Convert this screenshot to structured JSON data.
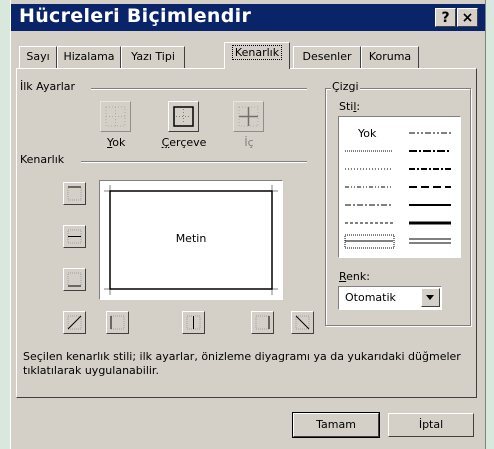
{
  "window": {
    "title": "Hücreleri Biçimlendir"
  },
  "title_buttons": {
    "help": "?",
    "close": "×"
  },
  "tabs": [
    {
      "label": "Sayı",
      "active": false
    },
    {
      "label": "Hizalama",
      "active": false
    },
    {
      "label": "Yazı Tipi",
      "active": false
    },
    {
      "label": "Kenarlık",
      "active": true
    },
    {
      "label": "Desenler",
      "active": false
    },
    {
      "label": "Koruma",
      "active": false
    }
  ],
  "presets": {
    "heading": "İlk Ayarlar",
    "none_first": "Y",
    "none_rest": "ok",
    "outline_first": "Ç",
    "outline_rest": "erçeve",
    "inside": "İç"
  },
  "border": {
    "heading": "Kenarlık",
    "preview_text": "Metin"
  },
  "line": {
    "heading": "Çizgi",
    "style_first": "Sti",
    "style_u": "l",
    "style_rest": ":",
    "none_label": "Yok",
    "color_first": "R",
    "color_rest": "enk:",
    "color_value": "Otomatik"
  },
  "hint": "Seçilen kenarlık stili; ilk ayarlar, önizleme diyagramı ya da yukarıdaki düğmeler tıklatılarak uygulanabilir.",
  "buttons": {
    "ok": "Tamam",
    "cancel": "İptal"
  },
  "colors": {
    "titlebar": "#0a246a",
    "dialog": "#d4d0c8",
    "desktop": "#d8e8dc"
  }
}
